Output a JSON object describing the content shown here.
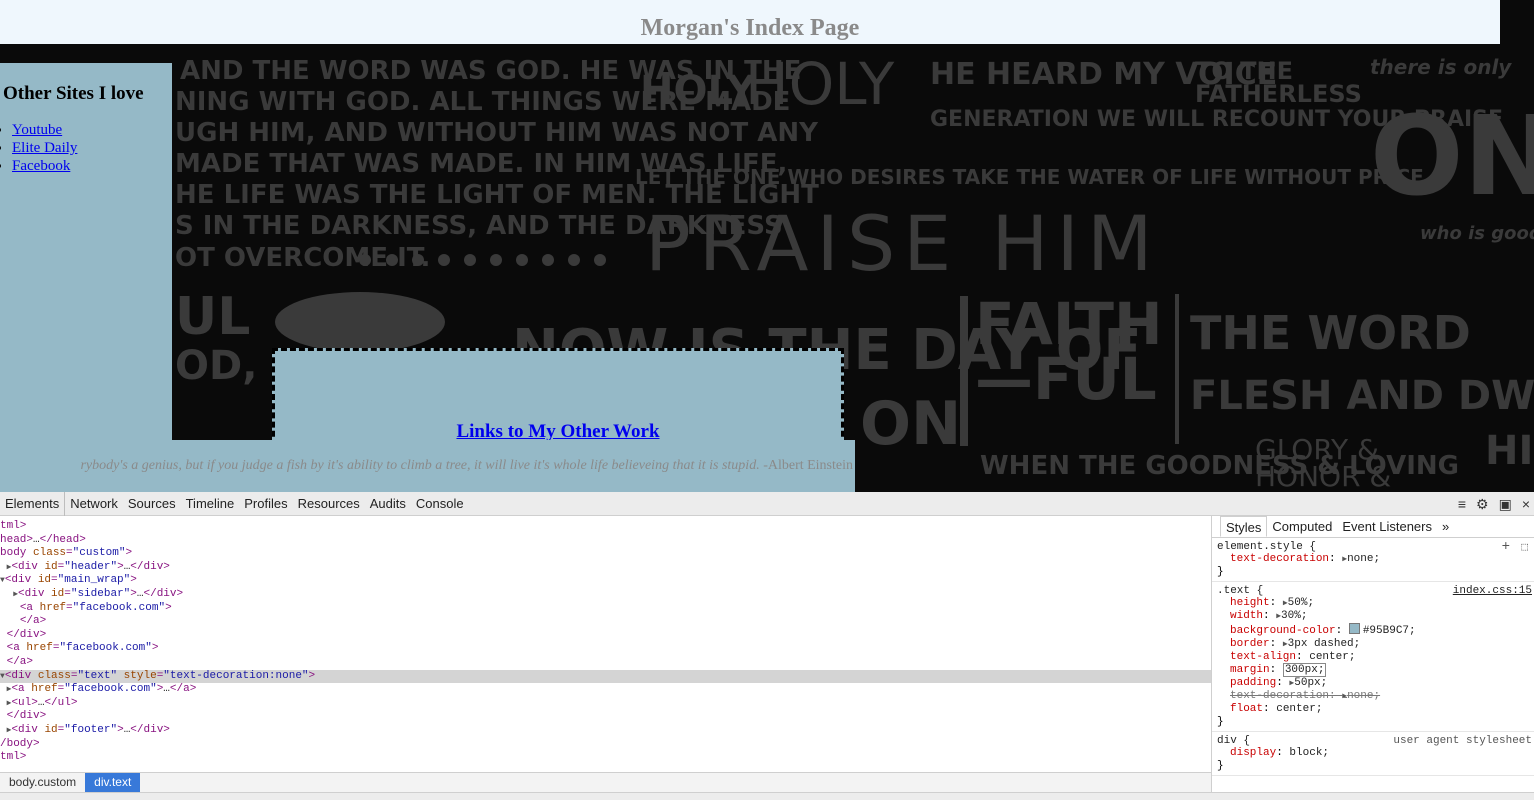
{
  "page": {
    "header_title": "Morgan's Index Page",
    "sidebar": {
      "heading": "Other Sites I love",
      "links": [
        "Youtube",
        "Elite Daily",
        "Facebook"
      ]
    },
    "text_box": {
      "link": "Links to My Other Work"
    },
    "footer": {
      "quote": "rybody's a genius, but if you judge a fish by it's ability to climb a tree, it will live it's whole life believeing that it is stupid.",
      "author": "-Albert Einstein"
    }
  },
  "devtools": {
    "tabs": [
      "Elements",
      "Network",
      "Sources",
      "Timeline",
      "Profiles",
      "Resources",
      "Audits",
      "Console"
    ],
    "active_tab": "Elements",
    "toolbar_icons": [
      "console-drawer-icon",
      "gear-icon",
      "dock-icon",
      "close-icon"
    ],
    "dom_lines": [
      {
        "indent": "",
        "arrow": "",
        "parts": [
          [
            "tag",
            "tml>"
          ]
        ]
      },
      {
        "indent": "",
        "arrow": "",
        "parts": [
          [
            "tag",
            "head>"
          ],
          [
            "txt",
            "…"
          ],
          [
            "tag",
            "</head>"
          ]
        ]
      },
      {
        "indent": "",
        "arrow": "",
        "parts": [
          [
            "tag",
            "body "
          ],
          [
            "attr",
            "class"
          ],
          [
            "tag",
            "="
          ],
          [
            "val",
            "\"custom\""
          ],
          [
            "tag",
            ">"
          ]
        ]
      },
      {
        "indent": " ",
        "arrow": "▶",
        "parts": [
          [
            "tag",
            "<div "
          ],
          [
            "attr",
            "id"
          ],
          [
            "tag",
            "="
          ],
          [
            "val",
            "\"header\""
          ],
          [
            "tag",
            ">"
          ],
          [
            "txt",
            "…"
          ],
          [
            "tag",
            "</div>"
          ]
        ]
      },
      {
        "indent": "",
        "arrow": "▼",
        "parts": [
          [
            "tag",
            "<div "
          ],
          [
            "attr",
            "id"
          ],
          [
            "tag",
            "="
          ],
          [
            "val",
            "\"main_wrap\""
          ],
          [
            "tag",
            ">"
          ]
        ]
      },
      {
        "indent": "  ",
        "arrow": "▶",
        "parts": [
          [
            "tag",
            "<div "
          ],
          [
            "attr",
            "id"
          ],
          [
            "tag",
            "="
          ],
          [
            "val",
            "\"sidebar\""
          ],
          [
            "tag",
            ">"
          ],
          [
            "txt",
            "…"
          ],
          [
            "tag",
            "</div>"
          ]
        ]
      },
      {
        "indent": "   ",
        "arrow": "",
        "parts": [
          [
            "tag",
            "<a "
          ],
          [
            "attr",
            "href"
          ],
          [
            "tag",
            "="
          ],
          [
            "val",
            "\"facebook.com\""
          ],
          [
            "tag",
            ">"
          ]
        ]
      },
      {
        "indent": "   ",
        "arrow": "",
        "parts": [
          [
            "tag",
            "</a>"
          ]
        ]
      },
      {
        "indent": " ",
        "arrow": "",
        "parts": [
          [
            "tag",
            "</div>"
          ]
        ]
      },
      {
        "indent": " ",
        "arrow": "",
        "parts": [
          [
            "tag",
            "<a "
          ],
          [
            "attr",
            "href"
          ],
          [
            "tag",
            "="
          ],
          [
            "val",
            "\"facebook.com\""
          ],
          [
            "tag",
            ">"
          ]
        ]
      },
      {
        "indent": " ",
        "arrow": "",
        "parts": [
          [
            "tag",
            "</a>"
          ]
        ]
      },
      {
        "indent": "",
        "arrow": "▼",
        "parts": [
          [
            "tag",
            "<div "
          ],
          [
            "attr",
            "class"
          ],
          [
            "tag",
            "="
          ],
          [
            "val",
            "\"text\""
          ],
          [
            "tag",
            " "
          ],
          [
            "attr",
            "style"
          ],
          [
            "tag",
            "="
          ],
          [
            "val",
            "\"text-decoration:none\""
          ],
          [
            "tag",
            ">"
          ]
        ],
        "selected": true
      },
      {
        "indent": " ",
        "arrow": "▶",
        "parts": [
          [
            "tag",
            "<a "
          ],
          [
            "attr",
            "href"
          ],
          [
            "tag",
            "="
          ],
          [
            "val",
            "\"facebook.com\""
          ],
          [
            "tag",
            ">"
          ],
          [
            "txt",
            "…"
          ],
          [
            "tag",
            "</a>"
          ]
        ]
      },
      {
        "indent": " ",
        "arrow": "▶",
        "parts": [
          [
            "tag",
            "<ul>"
          ],
          [
            "txt",
            "…"
          ],
          [
            "tag",
            "</ul>"
          ]
        ]
      },
      {
        "indent": " ",
        "arrow": "",
        "parts": [
          [
            "tag",
            "</div>"
          ]
        ]
      },
      {
        "indent": " ",
        "arrow": "▶",
        "parts": [
          [
            "tag",
            "<div "
          ],
          [
            "attr",
            "id"
          ],
          [
            "tag",
            "="
          ],
          [
            "val",
            "\"footer\""
          ],
          [
            "tag",
            ">"
          ],
          [
            "txt",
            "…"
          ],
          [
            "tag",
            "</div>"
          ]
        ]
      },
      {
        "indent": "",
        "arrow": "",
        "parts": [
          [
            "tag",
            "/body>"
          ]
        ]
      },
      {
        "indent": "",
        "arrow": "",
        "parts": [
          [
            "tag",
            "tml>"
          ]
        ]
      }
    ],
    "breadcrumbs": [
      "body.custom",
      "div.text"
    ],
    "styles_tabs": [
      "Styles",
      "Computed",
      "Event Listeners",
      "»"
    ],
    "rules": [
      {
        "selector": "element.style {",
        "source": "",
        "props": [
          {
            "name": "text-decoration",
            "value": "none;",
            "tri": true
          }
        ],
        "has_add": true
      },
      {
        "selector": ".text {",
        "source": "index.css:15",
        "props": [
          {
            "name": "height",
            "value": "50%;",
            "tri": true
          },
          {
            "name": "width",
            "value": "30%;",
            "tri": true
          },
          {
            "name": "background-color",
            "value": "#95B9C7;",
            "swatch": "#95B9C7"
          },
          {
            "name": "border",
            "value": "3px dashed;",
            "tri": true
          },
          {
            "name": "text-align",
            "value": "center;"
          },
          {
            "name": "margin",
            "value": "300px;",
            "editing": true
          },
          {
            "name": "padding",
            "value": "50px;",
            "tri": true
          },
          {
            "name": "text-decoration",
            "value": "none;",
            "tri": true,
            "struck": true
          },
          {
            "name": "float",
            "value": "center;"
          }
        ]
      },
      {
        "selector": "div {",
        "source": "user agent stylesheet",
        "ua": true,
        "props": [
          {
            "name": "display",
            "value": "block;"
          }
        ]
      }
    ]
  },
  "colors": {
    "box_blue": "#95B9C7",
    "header_bg": "#EFF7FD",
    "selected_crumb": "#3879D9"
  }
}
